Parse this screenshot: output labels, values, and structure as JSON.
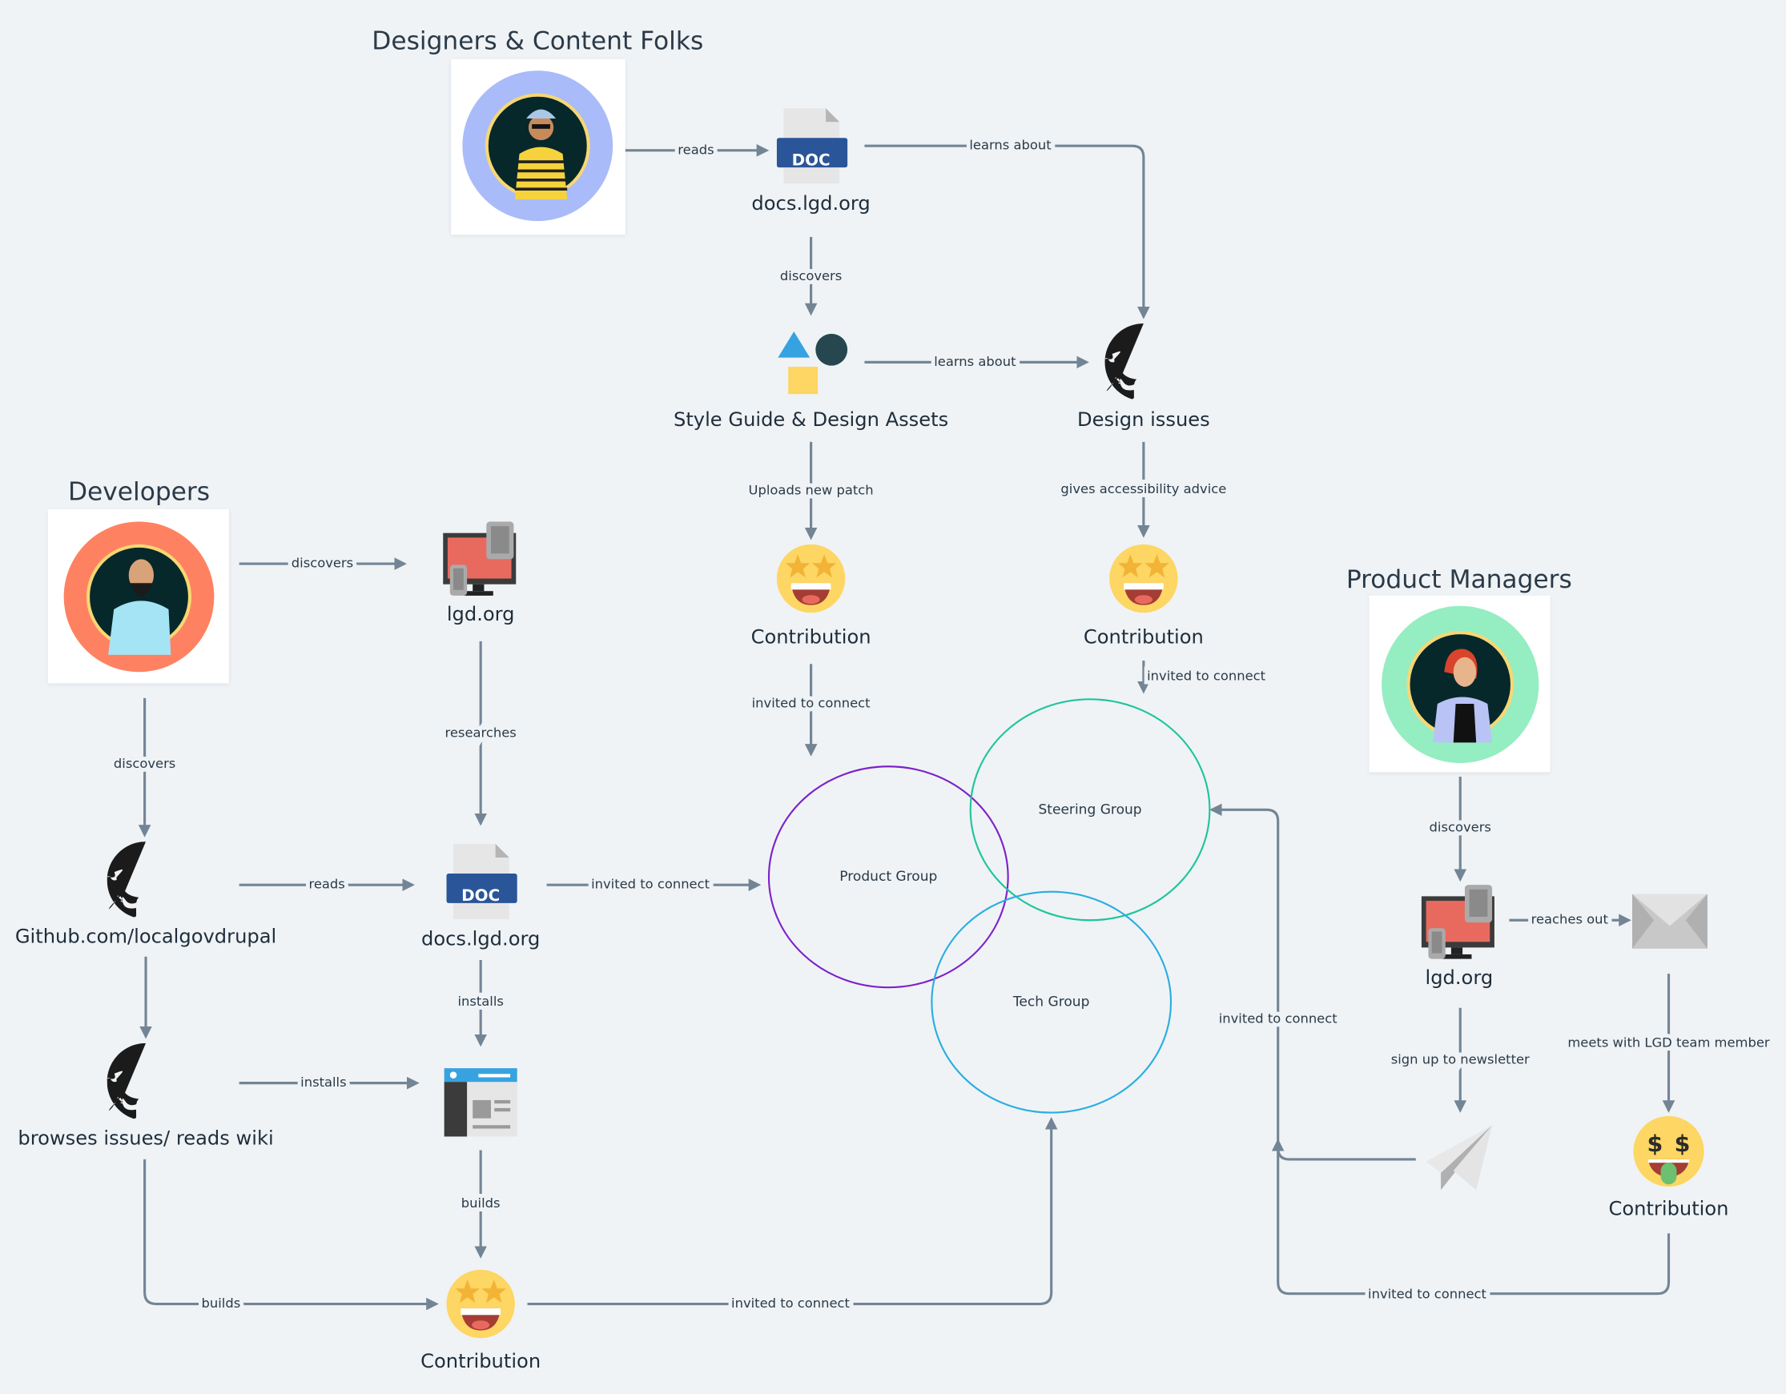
{
  "personas": {
    "designers": {
      "title": "Designers & Content Folks",
      "ring_color": "#a9bbf9"
    },
    "developers": {
      "title": "Developers",
      "ring_color": "#fe8261"
    },
    "product_managers": {
      "title": "Product Managers",
      "ring_color": "#95edc2"
    }
  },
  "nodes": {
    "design_docs": "docs.lgd.org",
    "style_guide": "Style Guide & Design Assets",
    "design_issues": "Design issues",
    "design_contribution_1": "Contribution",
    "design_contribution_2": "Contribution",
    "dev_lgd": "lgd.org",
    "dev_github": "Github.com/localgovdrupal",
    "dev_docs": "docs.lgd.org",
    "dev_issues": "browses issues/ reads wiki",
    "dev_contribution": "Contribution",
    "pm_lgd": "lgd.org",
    "pm_contribution": "Contribution"
  },
  "groups": {
    "product": {
      "label": "Product Group",
      "color": "#7d22c9"
    },
    "steering": {
      "label": "Steering Group",
      "color": "#1fc49d"
    },
    "tech": {
      "label": "Tech Group",
      "color": "#29aee0"
    }
  },
  "edges": {
    "designer_reads": "reads",
    "docs_learns_about": "learns about",
    "docs_discovers": "discovers",
    "style_learns_about": "learns about",
    "style_uploads": "Uploads new patch",
    "issues_advice": "gives accessibility advice",
    "contrib1_invited": "invited to connect",
    "contrib2_invited": "invited to connect",
    "dev_discovers_lgd": "discovers",
    "lgd_researches": "researches",
    "dev_discovers_github": "discovers",
    "github_reads": "reads",
    "docs_invited": "invited to connect",
    "docs_installs": "installs",
    "issues_installs": "installs",
    "browser_builds": "builds",
    "issues_builds": "builds",
    "dev_contrib_invited": "invited to connect",
    "pm_discovers": "discovers",
    "pm_reaches_out": "reaches out",
    "pm_meets": "meets with LGD team member",
    "pm_newsletter": "sign up to newsletter",
    "newsletter_invited": "invited to connect",
    "pm_contrib_invited": "invited to connect"
  },
  "icons": {
    "doc_badge": "DOC",
    "edge_color": "#738595",
    "background": "#eff3f6"
  }
}
